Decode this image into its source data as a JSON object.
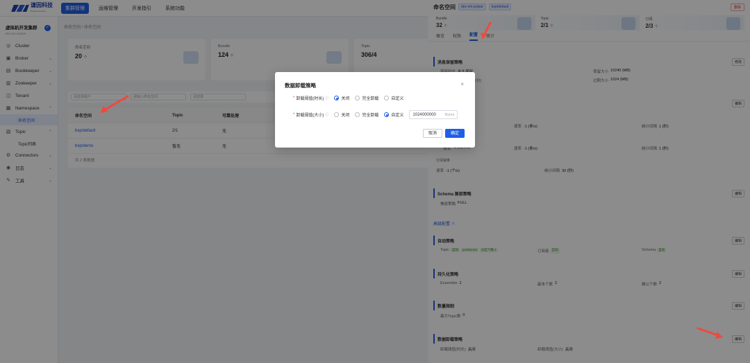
{
  "topbar": {
    "brand": "谦因科技",
    "brand_sub": "Pulsar Console",
    "nav": [
      "集群管理",
      "运维管理",
      "开发指引",
      "系统功能"
    ]
  },
  "sidebar": {
    "cluster_name": "虚拟机开发集群",
    "cluster_sub": "dev-vm-cluster",
    "items": [
      {
        "label": "Cluster",
        "icon": "cluster-icon"
      },
      {
        "label": "Broker",
        "icon": "broker-icon"
      },
      {
        "label": "Bookkeeper",
        "icon": "bookkeeper-icon"
      },
      {
        "label": "Zookeeper",
        "icon": "zookeeper-icon"
      },
      {
        "label": "Tenant",
        "icon": "tenant-icon"
      },
      {
        "label": "Namespace",
        "icon": "namespace-icon"
      }
    ],
    "namespace_sub": "命名空间",
    "topic": "Topic",
    "topic_sub": "Topic列表",
    "connectors": "Connectors",
    "monitor": "日志",
    "tools": "工具"
  },
  "main": {
    "breadcrumb": "命名空间 / 命名空间",
    "stats": [
      {
        "title": "命名空间",
        "value": "20",
        "unit": "个"
      },
      {
        "title": "Bundle",
        "value": "124",
        "unit": "个"
      },
      {
        "title": "Topic",
        "value": "306/4",
        "unit": ""
      }
    ],
    "filters": [
      "请选择租户",
      "请输入命名空间",
      "请选择"
    ],
    "search_label": "查",
    "table_headers": [
      "命名空间",
      "Topic",
      "可靠处理"
    ],
    "rows": [
      {
        "name": "bxp/default",
        "topic": "2/1",
        "flag": "无"
      },
      {
        "name": "bxp/demo",
        "topic": "暂无",
        "flag": "无"
      }
    ],
    "pager": "共 2 条数据"
  },
  "drawer": {
    "title": "命名空间",
    "tags": [
      "dev-vm-pulsar",
      "bxp/default"
    ],
    "close": "删除",
    "stats": [
      {
        "title": "Bundle",
        "value": "32",
        "unit": "个"
      },
      {
        "title": "Topic",
        "value": "2/1",
        "unit": "个"
      },
      {
        "title": "订阅",
        "value": "2/3",
        "unit": "个"
      }
    ],
    "tabs": [
      "概览",
      "权限",
      "配置",
      "审计"
    ],
    "retention": {
      "title": "消息保留策略",
      "edit": "修改",
      "k1": "保留时长",
      "v1": "永久保留",
      "k2": "保留大小",
      "v2": "10240 (MB)",
      "k3": "(分)",
      "k4": "过期大小",
      "v4": "1024 (MB)"
    },
    "dispatch": {
      "edit": "编辑",
      "rate1_k": "速率",
      "rate1_v": "-1 (条/s)",
      "period1_k": "统计间隔",
      "period1_v": "1 (秒)",
      "byte_k": "速率",
      "byte_v": "-1 (byte/s)",
      "rate2_k": "速率",
      "rate2_v": "-1 (条/s)",
      "period2_k": "统计间隔",
      "period2_v": "1 (秒)",
      "sub_title": "订阅速率",
      "rate3_k": "速率",
      "rate3_v": "-1 (个/s)",
      "period3_k": "统计间隔",
      "period3_v": "30 (秒)"
    },
    "schema": {
      "title": "Schema 兼容策略",
      "edit": "编辑",
      "k": "兼容策略",
      "v": "FULL"
    },
    "advanced": "高级配置",
    "autocreate": {
      "title": "自动策略",
      "edit": "编辑",
      "topic_k": "Topic",
      "topic_tags": [
        "自动",
        "partitioned",
        "分区个数 1"
      ],
      "sub_k": "订阅者",
      "sub_tag": "自动",
      "schema_k": "Schema",
      "schema_tag": "自动"
    },
    "persistence": {
      "title": "持久化策略",
      "edit": "编辑",
      "k1": "Ensemble",
      "v1": "2",
      "k2": "副本个数",
      "v2": "2",
      "k3": "确认个数",
      "v3": "2"
    },
    "limits": {
      "title": "数量限制",
      "edit": "编辑",
      "k": "最大Topic数",
      "v": "0"
    },
    "offload": {
      "title": "数据卸载策略",
      "edit": "编辑",
      "k1": "卸载阈值(时长)",
      "v1": "关闭",
      "k2": "卸载阈值(大小)",
      "v2": "关闭"
    }
  },
  "modal": {
    "title": "数据卸载策略",
    "row1_label": "卸载阈值(时长)",
    "row2_label": "卸载阈值(大小)",
    "opt_off": "关闭",
    "opt_full": "完全卸载",
    "opt_custom": "自定义",
    "size_value": "1024000000",
    "size_unit": "Bytes",
    "cancel": "取消",
    "ok": "确定"
  },
  "colors": {
    "accent": "#1f5fe6",
    "arrow": "#f2483d"
  }
}
